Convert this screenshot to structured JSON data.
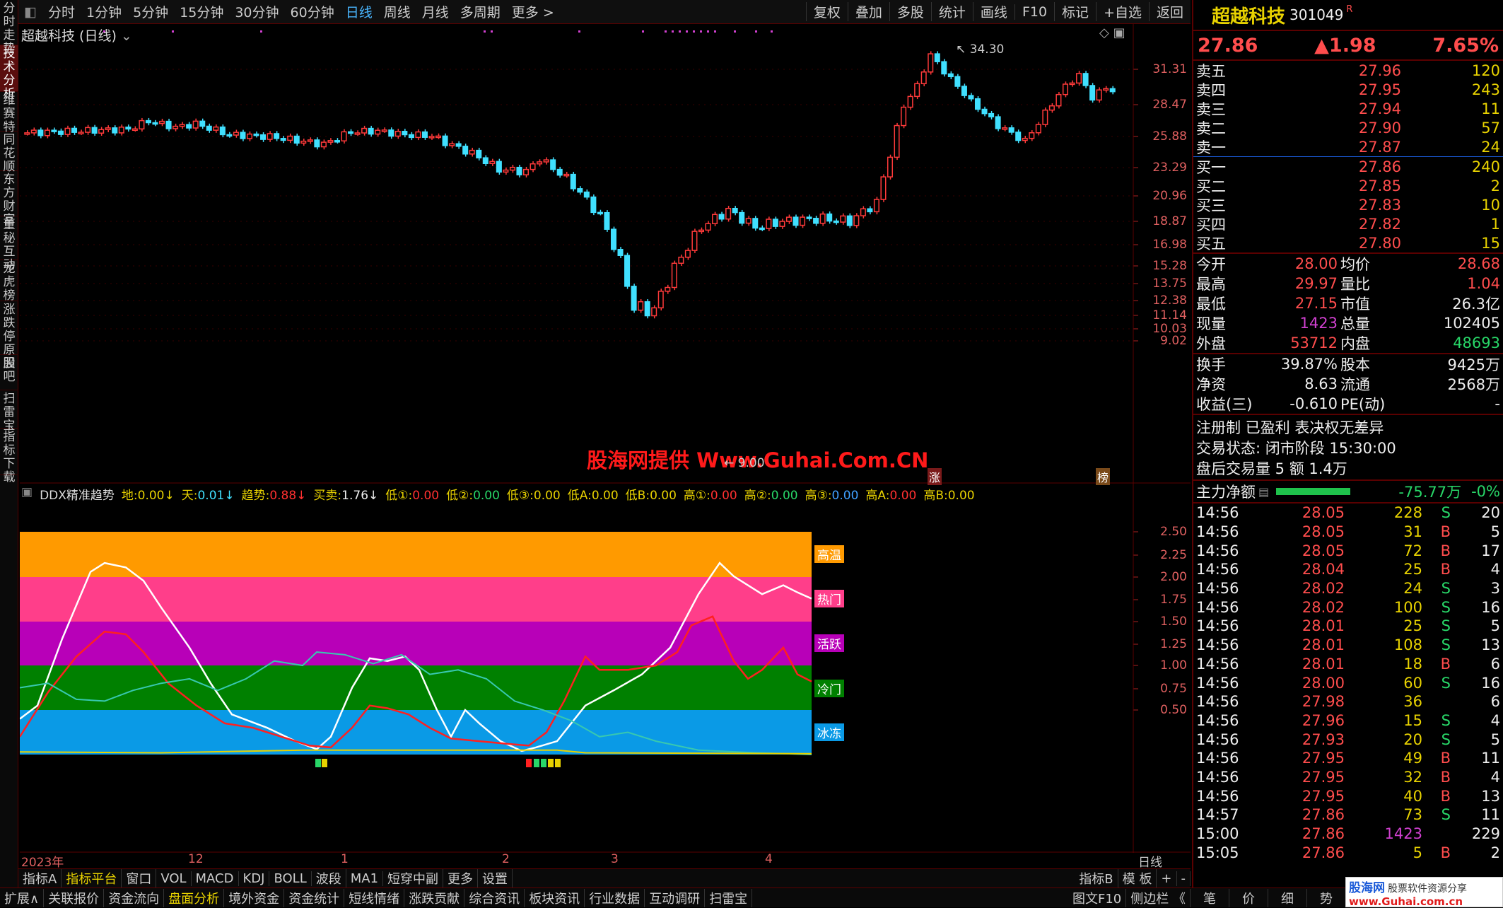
{
  "left_tabs": [
    "分时走势",
    "技术分析",
    "维赛特",
    "同花顺",
    "东方财富",
    "董秘互动",
    "龙虎榜",
    "涨跌停原因",
    "股吧",
    "扫雷宝",
    "指标下载"
  ],
  "toolbar": {
    "periods": [
      "分时",
      "1分钟",
      "5分钟",
      "15分钟",
      "30分钟",
      "60分钟",
      "日线",
      "周线",
      "月线",
      "多周期",
      "更多 >"
    ],
    "active_period": "日线",
    "right_buttons": [
      "复权",
      "叠加",
      "多股",
      "统计",
      "画线",
      "F10",
      "标记",
      "+自选",
      "返回"
    ]
  },
  "chart": {
    "title": "超越科技 (日线)",
    "price_ticks": [
      "31.31",
      "28.47",
      "25.88",
      "23.29",
      "20.96",
      "18.87",
      "16.98",
      "15.28",
      "13.75",
      "12.38",
      "11.14",
      "10.03",
      "9.02"
    ],
    "high_marker": "34.30",
    "low_marker": "9.00",
    "watermark": "股海网提供 Www.Guhai.Com.CN",
    "tag_zhang": "涨",
    "tag_bang": "榜"
  },
  "indicator": {
    "name": "DDX精准趋势",
    "params": [
      {
        "label": "地:",
        "value": "0.00↓",
        "color": "#e8d200"
      },
      {
        "label": "天:",
        "value": "0.01↓",
        "color": "#40e0ff"
      },
      {
        "label": "趋势:",
        "value": "0.88↓",
        "color": "#ff3030"
      },
      {
        "label": "买卖:",
        "value": "1.76↓",
        "color": "#eeeeee"
      },
      {
        "label": "低①:",
        "value": "0.00",
        "color": "#ff3030"
      },
      {
        "label": "低②:",
        "value": "0.00",
        "color": "#28d768"
      },
      {
        "label": "低③:",
        "value": "0.00",
        "color": "#e8d200"
      },
      {
        "label": "低A:",
        "value": "0.00",
        "color": "#e8d200"
      },
      {
        "label": "低B:",
        "value": "0.00",
        "color": "#e8d200"
      },
      {
        "label": "高①:",
        "value": "0.00",
        "color": "#ff3030"
      },
      {
        "label": "高②:",
        "value": "0.00",
        "color": "#28d768"
      },
      {
        "label": "高③:",
        "value": "0.00",
        "color": "#40a0ff"
      },
      {
        "label": "高A:",
        "value": "0.00",
        "color": "#ff3030"
      },
      {
        "label": "高B:",
        "value": "0.00",
        "color": "#e8d200"
      }
    ],
    "ticks": [
      "2.50",
      "2.25",
      "2.00",
      "1.75",
      "1.50",
      "1.25",
      "1.00",
      "0.75",
      "0.50"
    ],
    "zones": [
      {
        "label": "高温",
        "color": "#ff9a00"
      },
      {
        "label": "热门",
        "color": "#ff3e8a"
      },
      {
        "label": "活跃",
        "color": "#b800b8"
      },
      {
        "label": "冷门",
        "color": "#008000"
      },
      {
        "label": "冰冻",
        "color": "#0a9ae6"
      }
    ],
    "x_labels": [
      "2023年",
      "12",
      "1",
      "2",
      "3",
      "4"
    ],
    "period_label": "日线"
  },
  "bottom_bar1": {
    "items": [
      "指标A",
      "指标平台",
      "窗口",
      "VOL",
      "MACD",
      "KDJ",
      "BOLL",
      "波段",
      "MA1",
      "短穿中副",
      "更多",
      "设置"
    ],
    "active": "指标平台",
    "right": [
      "指标B",
      "模 板",
      "+",
      "-"
    ]
  },
  "bottom_bar2": {
    "items": [
      "扩展∧",
      "关联报价",
      "资金流向",
      "盘面分析",
      "境外资金",
      "资金统计",
      "短线情绪",
      "涨跌贡献",
      "综合资讯",
      "板块资讯",
      "行业数据",
      "互动调研",
      "扫雷宝"
    ],
    "active": "盘面分析",
    "right": [
      "图文F10",
      "侧边栏 《",
      "笔",
      "价",
      "细",
      "势"
    ]
  },
  "quote": {
    "name": "超越科技",
    "code": "301049",
    "flag": "R",
    "price": "27.86",
    "change": "▲1.98",
    "pct": "7.65%",
    "asks": [
      {
        "label": "卖五",
        "price": "27.96",
        "vol": "120"
      },
      {
        "label": "卖四",
        "price": "27.95",
        "vol": "243"
      },
      {
        "label": "卖三",
        "price": "27.94",
        "vol": "11"
      },
      {
        "label": "卖二",
        "price": "27.90",
        "vol": "57"
      },
      {
        "label": "卖一",
        "price": "27.87",
        "vol": "24"
      }
    ],
    "bids": [
      {
        "label": "买一",
        "price": "27.86",
        "vol": "240"
      },
      {
        "label": "买二",
        "price": "27.85",
        "vol": "2"
      },
      {
        "label": "买三",
        "price": "27.83",
        "vol": "10"
      },
      {
        "label": "买四",
        "price": "27.82",
        "vol": "1"
      },
      {
        "label": "买五",
        "price": "27.80",
        "vol": "15"
      }
    ],
    "stats1": [
      {
        "l1": "今开",
        "v1": "28.00",
        "c1": "red",
        "l2": "均价",
        "v2": "28.68",
        "c2": "red"
      },
      {
        "l1": "最高",
        "v1": "29.97",
        "c1": "red",
        "l2": "量比",
        "v2": "1.04",
        "c2": "red"
      },
      {
        "l1": "最低",
        "v1": "27.15",
        "c1": "red",
        "l2": "市值",
        "v2": "26.3亿",
        "c2": "white"
      },
      {
        "l1": "现量",
        "v1": "1423",
        "c1": "magenta",
        "l2": "总量",
        "v2": "102405",
        "c2": "white"
      },
      {
        "l1": "外盘",
        "v1": "53712",
        "c1": "red",
        "l2": "内盘",
        "v2": "48693",
        "c2": "green"
      }
    ],
    "stats2": [
      {
        "l1": "换手",
        "v1": "39.87%",
        "l2": "股本",
        "v2": "9425万"
      },
      {
        "l1": "净资",
        "v1": "8.63",
        "l2": "流通",
        "v2": "2568万"
      },
      {
        "l1": "收益(三)",
        "v1": "-0.610",
        "l2": "PE(动)",
        "v2": "-"
      }
    ],
    "notice": "注册制 已盈利 表决权无差异",
    "trade_status": "交易状态: 闭市阶段 15:30:00",
    "after_hours": "盘后交易量 5 额 1.4万",
    "main_flow_label": "主力净额",
    "main_flow_value": "-75.77万",
    "main_flow_pct": "-0%"
  },
  "ticks_table": [
    {
      "t": "14:56",
      "p": "28.05",
      "v": "228",
      "s": "S",
      "n": "20"
    },
    {
      "t": "14:56",
      "p": "28.05",
      "v": "31",
      "s": "B",
      "n": "5"
    },
    {
      "t": "14:56",
      "p": "28.05",
      "v": "72",
      "s": "B",
      "n": "17"
    },
    {
      "t": "14:56",
      "p": "28.04",
      "v": "25",
      "s": "B",
      "n": "4"
    },
    {
      "t": "14:56",
      "p": "28.02",
      "v": "24",
      "s": "S",
      "n": "3"
    },
    {
      "t": "14:56",
      "p": "28.02",
      "v": "100",
      "s": "S",
      "n": "16"
    },
    {
      "t": "14:56",
      "p": "28.01",
      "v": "25",
      "s": "S",
      "n": "5"
    },
    {
      "t": "14:56",
      "p": "28.01",
      "v": "108",
      "s": "S",
      "n": "13"
    },
    {
      "t": "14:56",
      "p": "28.01",
      "v": "18",
      "s": "B",
      "n": "6"
    },
    {
      "t": "14:56",
      "p": "28.00",
      "v": "60",
      "s": "S",
      "n": "16"
    },
    {
      "t": "14:56",
      "p": "27.98",
      "v": "36",
      "s": "",
      "n": "6"
    },
    {
      "t": "14:56",
      "p": "27.96",
      "v": "15",
      "s": "S",
      "n": "4"
    },
    {
      "t": "14:56",
      "p": "27.93",
      "v": "20",
      "s": "S",
      "n": "5"
    },
    {
      "t": "14:56",
      "p": "27.95",
      "v": "49",
      "s": "B",
      "n": "11"
    },
    {
      "t": "14:56",
      "p": "27.95",
      "v": "32",
      "s": "B",
      "n": "4"
    },
    {
      "t": "14:56",
      "p": "27.95",
      "v": "40",
      "s": "B",
      "n": "13"
    },
    {
      "t": "14:57",
      "p": "27.86",
      "v": "73",
      "s": "S",
      "n": "11"
    },
    {
      "t": "15:00",
      "p": "27.86",
      "v": "1423",
      "s": "",
      "n": "229"
    },
    {
      "t": "15:05",
      "p": "27.86",
      "v": "5",
      "s": "B",
      "n": "2"
    }
  ],
  "footer_watermark": {
    "brand": "股海网",
    "slogan": "股票软件资源分享",
    "url": "www.Guhai.com.cn"
  }
}
